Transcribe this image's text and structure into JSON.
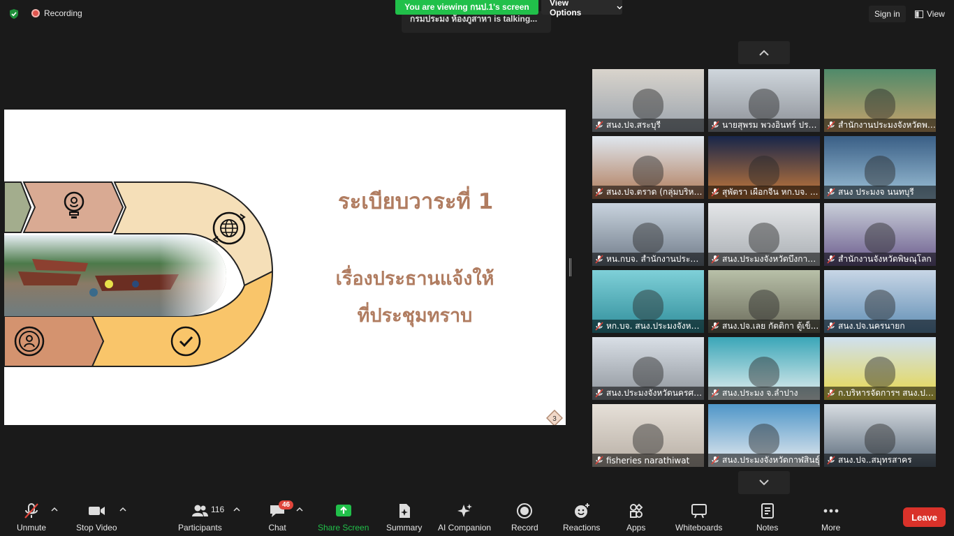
{
  "top": {
    "recording": "Recording",
    "viewing": "You are viewing กนป.1's screen",
    "view_options": "View Options",
    "speaker": "กรมประมง ห้องภูสาหา is talking...",
    "sign_in": "Sign in",
    "view": "View"
  },
  "slide": {
    "title": "ระเบียบวาระที่ 1",
    "line1": "เรื่องประธานแจ้งให้",
    "line2": "ที่ประชุมทราบ",
    "page": "3"
  },
  "gallery": {
    "participants": [
      "สนง.ปจ.สระบุรี",
      "นายสุพรม พวงอินทร์ ประ...",
      "สำนักงานประมงจังหวัดพร...",
      "สนง.ปจ.ตราด (กลุ่มบริหา...",
      "สุพัตรา เผือกจีน หก.บจ. ...",
      "สนง ประมงจ นนทบุรี",
      "หน.กบจ. สำนักงานประมง...",
      "สนง.ประมงจังหวัดบึงกาฬ ...",
      "สำนักงานจังหวัดพิษณุโลก",
      "หก.บจ. สนง.ประมงจังหวัด...",
      "สนง.ปจ.เลย กัตติกา ตู้เข็...",
      "สนง.ปจ.นครนายก",
      "สนง.ประมงจังหวัดนครศรีธ...",
      "สนง.ประมง จ.ลำปาง",
      "ก.บริหารจัดการฯ สนง.ปม...",
      "fisheries narathiwat",
      "สนง.ประมงจังหวัดกาฬสินธุ์",
      "สนง.ปจ..สมุทรสาคร"
    ]
  },
  "toolbar": {
    "unmute": "Unmute",
    "stop_video": "Stop Video",
    "participants": "Participants",
    "participants_count": "116",
    "chat": "Chat",
    "chat_badge": "46",
    "share_screen": "Share Screen",
    "summary": "Summary",
    "ai_companion": "AI Companion",
    "record": "Record",
    "reactions": "Reactions",
    "apps": "Apps",
    "whiteboards": "Whiteboards",
    "notes": "Notes",
    "more": "More",
    "leave": "Leave"
  },
  "colors": {
    "share_green": "#21c04a",
    "leave_red": "#d9322a",
    "slide_text": "#b07c60"
  }
}
